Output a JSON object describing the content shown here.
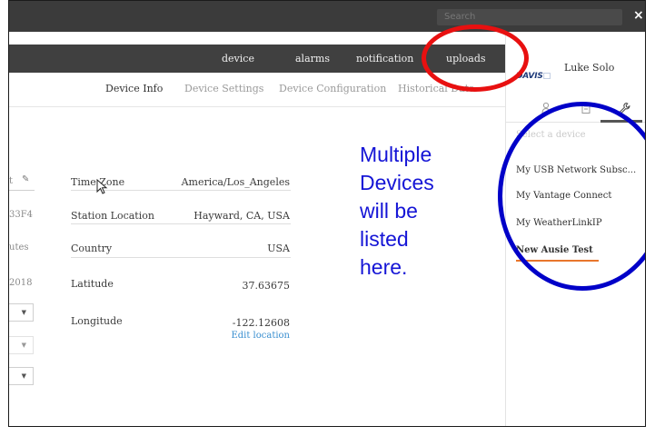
{
  "topbar": {
    "search_placeholder": "Search",
    "close_label": "×"
  },
  "nav": {
    "tabs": [
      "device",
      "alarms",
      "notification",
      "uploads"
    ]
  },
  "subtabs": [
    "Device Info",
    "Device Settings",
    "Device Configuration",
    "Historical Data"
  ],
  "left_column": {
    "values": [
      "t",
      "33F4",
      "utes",
      "2018"
    ]
  },
  "device_info": {
    "rows": [
      {
        "label": "Time Zone",
        "value": "America/Los_Angeles"
      },
      {
        "label": "Station Location",
        "value": "Hayward, CA, USA"
      },
      {
        "label": "Country",
        "value": "USA"
      },
      {
        "label": "Latitude",
        "value": "37.63675"
      },
      {
        "label": "Longitude",
        "value": "-122.12608"
      }
    ],
    "edit_location_label": "Edit location"
  },
  "sidebar": {
    "logo_text": "DAVIS",
    "user_name": "Luke Solo",
    "select_label": "Select a device",
    "devices": [
      "My USB Network Subsc...",
      "My Vantage Connect",
      "My WeatherLinkIP",
      "New Ausie Test"
    ]
  },
  "annotation": {
    "lines": [
      "Multiple",
      "Devices",
      "will be",
      "listed",
      "here."
    ]
  },
  "colors": {
    "highlight_red": "#e81010",
    "highlight_blue": "#0000c8",
    "annotation_text": "#1515d6",
    "active_device_underline": "#e8762c",
    "link": "#3a8fd0"
  }
}
